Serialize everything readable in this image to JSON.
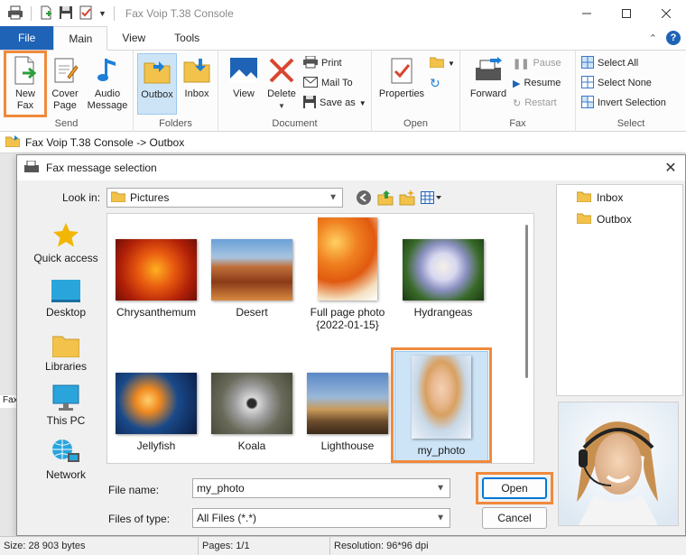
{
  "window": {
    "title": "Fax Voip T.38 Console"
  },
  "tabs": [
    {
      "label": "File"
    },
    {
      "label": "Main"
    },
    {
      "label": "View"
    },
    {
      "label": "Tools"
    }
  ],
  "ribbon": {
    "send": {
      "label": "Send",
      "new_fax": "New Fax",
      "new_fax_l1": "New",
      "new_fax_l2": "Fax",
      "cover_l1": "Cover",
      "cover_l2": "Page",
      "audio_l1": "Audio",
      "audio_l2": "Message"
    },
    "folders": {
      "label": "Folders",
      "outbox": "Outbox",
      "inbox": "Inbox"
    },
    "document": {
      "label": "Document",
      "view": "View",
      "delete": "Delete",
      "print": "Print",
      "mail_to": "Mail To",
      "save_as": "Save as"
    },
    "open": {
      "label": "Open",
      "properties": "Properties"
    },
    "fax": {
      "label": "Fax",
      "forward": "Forward",
      "pause": "Pause",
      "resume": "Resume",
      "restart": "Restart"
    },
    "select": {
      "label": "Select",
      "select_all": "Select All",
      "select_none": "Select None",
      "invert": "Invert Selection"
    }
  },
  "breadcrumb": "Fax Voip T.38 Console -> Outbox",
  "behind_strip_text": "Fax",
  "dialog": {
    "title": "Fax message selection",
    "look_in_label": "Look in:",
    "look_in_value": "Pictures",
    "places": [
      {
        "label": "Quick access",
        "icon": "star-icon"
      },
      {
        "label": "Desktop",
        "icon": "desktop-icon"
      },
      {
        "label": "Libraries",
        "icon": "folder-icon"
      },
      {
        "label": "This PC",
        "icon": "monitor-icon"
      },
      {
        "label": "Network",
        "icon": "network-icon"
      }
    ],
    "files": [
      {
        "name": "Chrysanthemum",
        "selected": false
      },
      {
        "name": "Desert",
        "selected": false
      },
      {
        "name": "Full page photo {2022-01-15}",
        "line1": "Full page photo",
        "line2": "{2022-01-15}",
        "selected": false
      },
      {
        "name": "Hydrangeas",
        "selected": false
      },
      {
        "name": "Jellyfish",
        "selected": false
      },
      {
        "name": "Koala",
        "selected": false
      },
      {
        "name": "Lighthouse",
        "selected": false
      },
      {
        "name": "my_photo",
        "selected": true
      }
    ],
    "file_name_label": "File name:",
    "file_name_value": "my_photo",
    "files_of_type_label": "Files of type:",
    "files_of_type_value": "All Files (*.*)",
    "open_button": "Open",
    "cancel_button": "Cancel",
    "folder_tree": [
      {
        "label": "Inbox"
      },
      {
        "label": "Outbox"
      }
    ]
  },
  "status": {
    "size": "Size: 28 903 bytes",
    "pages": "Pages: 1/1",
    "resolution": "Resolution: 96*96 dpi"
  },
  "colors": {
    "accent": "#1e63b6",
    "highlight": "#f08a3c",
    "selection": "#cde4f7"
  }
}
